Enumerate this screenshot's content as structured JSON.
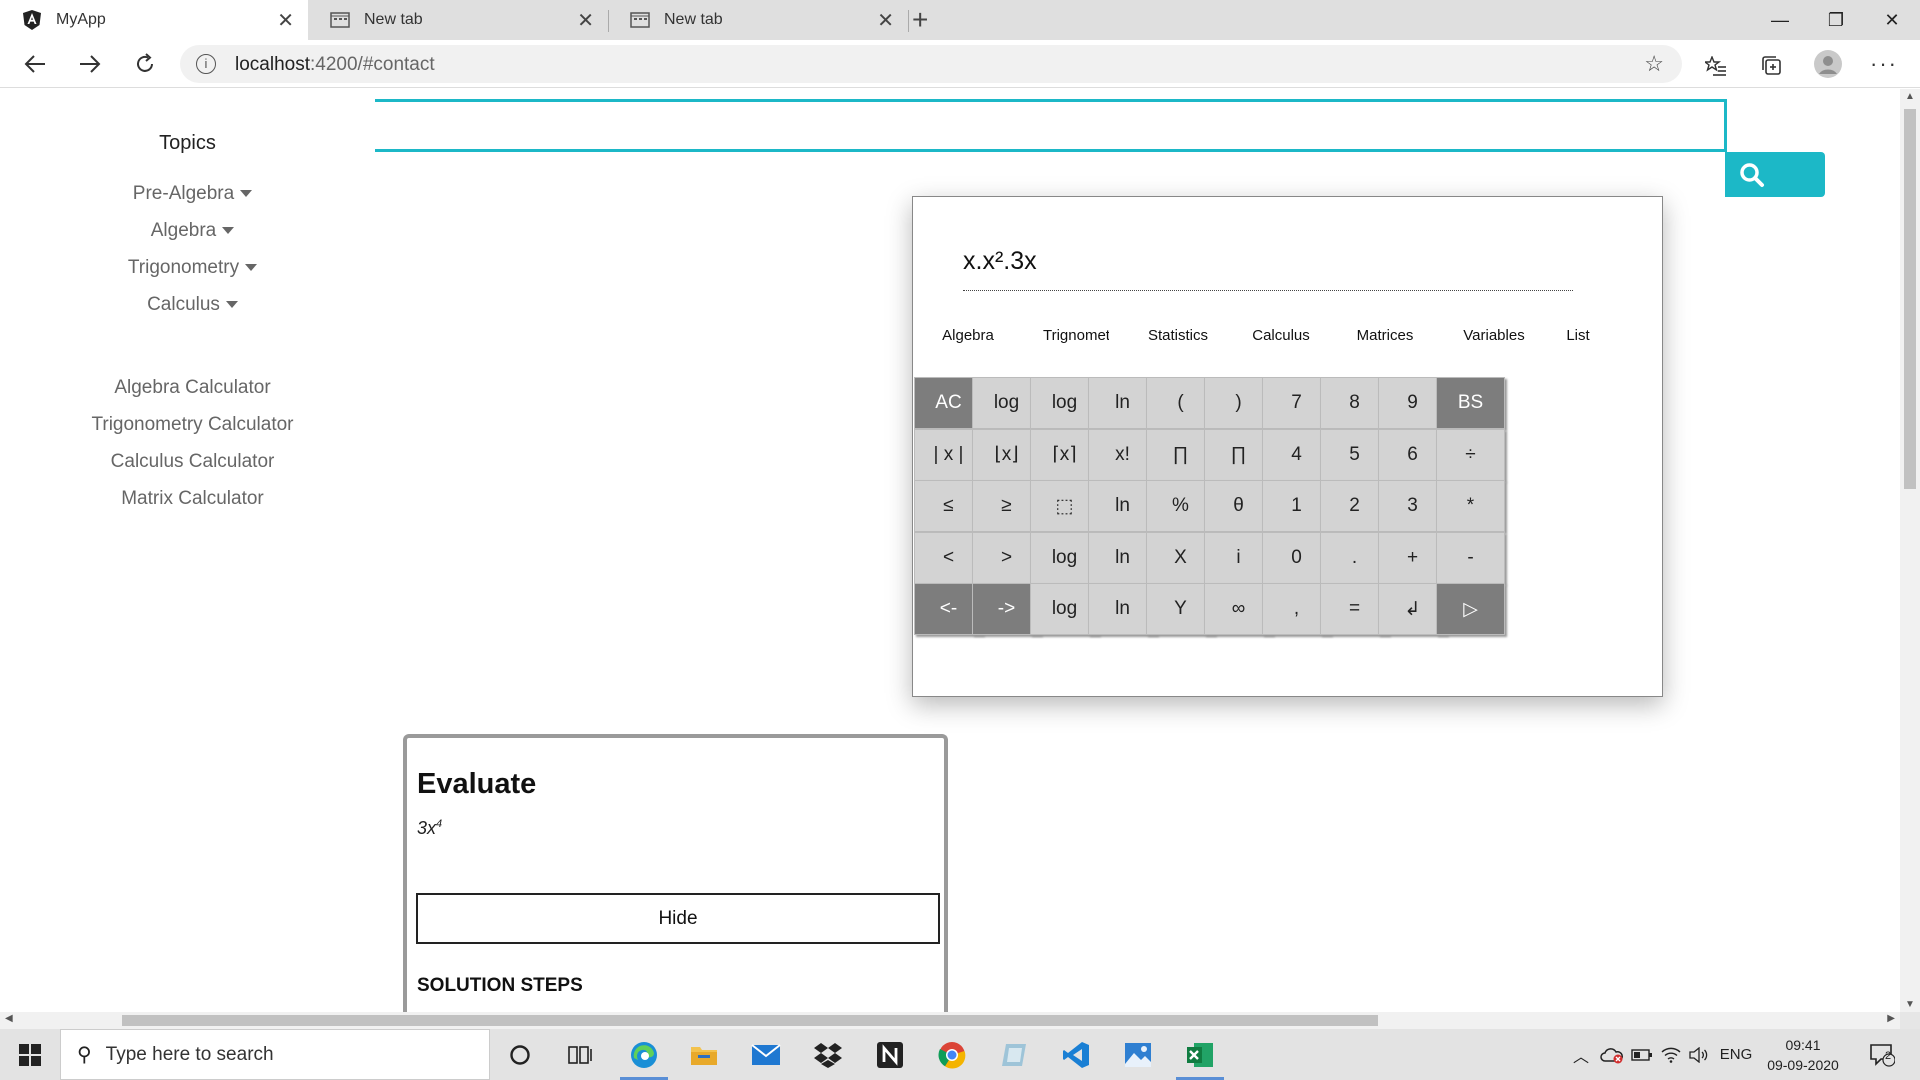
{
  "browser": {
    "tabs": [
      {
        "title": "MyApp",
        "close": "✕"
      },
      {
        "title": "New tab",
        "close": "✕"
      },
      {
        "title": "New tab",
        "close": "✕"
      }
    ],
    "new_tab": "+",
    "window": {
      "minimize": "—",
      "maximize": "❐",
      "close": "✕"
    },
    "url_host": "localhost",
    "url_path": ":4200/#contact"
  },
  "sidebar": {
    "title": "Topics",
    "topics": [
      "Pre-Algebra",
      "Algebra",
      "Trigonometry",
      "Calculus"
    ],
    "calculators": [
      "Algebra Calculator",
      "Trigonometry Calculator",
      "Calculus Calculator",
      "Matrix Calculator"
    ]
  },
  "calculator": {
    "expression": "x.x².3x",
    "tabs": [
      "Algebra",
      "Trignometry",
      "Statistics",
      "Calculus",
      "Matrices",
      "Variables",
      "List"
    ],
    "keys": [
      [
        "AC",
        "log",
        "log",
        "ln",
        "(",
        ")",
        "7",
        "8",
        "9",
        "BS"
      ],
      [
        "| x |",
        "⌊x⌋",
        "⌈x⌉",
        "x!",
        "∏",
        "∏",
        "4",
        "5",
        "6",
        "÷"
      ],
      [
        "≤",
        "≥",
        "⬚",
        "ln",
        "%",
        "θ",
        "1",
        "2",
        "3",
        "*"
      ],
      [
        "<",
        ">",
        "log",
        "ln",
        "X",
        "i",
        "0",
        ".",
        "+",
        "-"
      ],
      [
        "<-",
        "->",
        "log",
        "ln",
        "Y",
        "∞",
        ",",
        "=",
        "↲",
        "▷"
      ]
    ]
  },
  "card": {
    "title": "Evaluate",
    "expr_base": "3x",
    "expr_exp": "4",
    "hide_label": "Hide",
    "steps_label": "SOLUTION STEPS"
  },
  "taskbar": {
    "search_placeholder": "Type here to search",
    "language": "ENG",
    "time": "09:41",
    "date": "09-09-2020",
    "notifications": "2"
  },
  "colors": {
    "accent": "#1cb8c7",
    "key_dark": "#7d7d7d",
    "key_light": "#d3d3d3"
  }
}
